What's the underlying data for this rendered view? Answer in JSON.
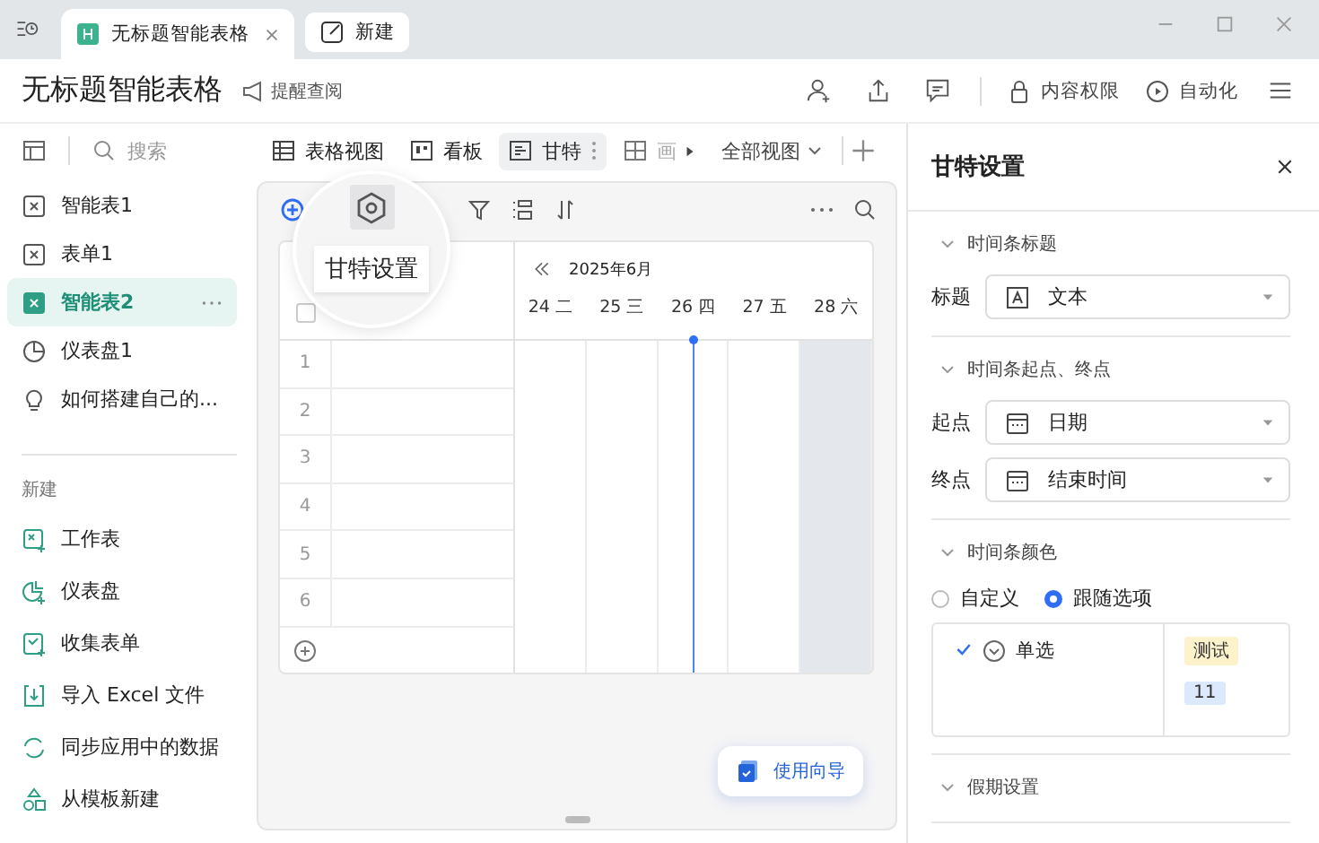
{
  "window": {
    "tabs": [
      {
        "title": "无标题智能表格",
        "selected": true,
        "kind": "doc"
      },
      {
        "title": "新建",
        "selected": false,
        "kind": "new"
      }
    ]
  },
  "header": {
    "title": "无标题智能表格",
    "remind": "提醒查阅",
    "actions": [
      {
        "label": "内容权限",
        "kind": "lock"
      },
      {
        "label": "自动化",
        "kind": "auto"
      }
    ]
  },
  "sidebar": {
    "search_placeholder": "搜索",
    "items": [
      {
        "label": "智能表1",
        "kind": "sheet",
        "selected": false
      },
      {
        "label": "表单1",
        "kind": "sheet",
        "selected": false
      },
      {
        "label": "智能表2",
        "kind": "sheet",
        "selected": true
      },
      {
        "label": "仪表盘1",
        "kind": "dashboard",
        "selected": false
      },
      {
        "label": "如何搭建自己的...",
        "kind": "bulb",
        "selected": false
      }
    ],
    "new_heading": "新建",
    "new_items": [
      {
        "label": "工作表",
        "kind": "sheet"
      },
      {
        "label": "仪表盘",
        "kind": "dashboard"
      },
      {
        "label": "收集表单",
        "kind": "form"
      },
      {
        "label": "导入 Excel 文件",
        "kind": "import"
      },
      {
        "label": "同步应用中的数据",
        "kind": "sync"
      },
      {
        "label": "从模板新建",
        "kind": "template"
      }
    ]
  },
  "views": [
    {
      "label": "表格视图",
      "kind": "grid",
      "selected": false
    },
    {
      "label": "看板",
      "kind": "board",
      "selected": false
    },
    {
      "label": "甘特",
      "kind": "gantt",
      "selected": true
    },
    {
      "label": "画",
      "kind": "gallery",
      "selected": false
    }
  ],
  "all_views": "全部视图",
  "tooltip": "甘特设置",
  "grid": {
    "select_all_checked": false,
    "rows": [
      "1",
      "2",
      "3",
      "4",
      "5",
      "6"
    ]
  },
  "gantt": {
    "month": "2025年6月",
    "days": [
      {
        "label": "24 二",
        "weekend": false,
        "today": false
      },
      {
        "label": "25 三",
        "weekend": false,
        "today": false
      },
      {
        "label": "26 四",
        "weekend": false,
        "today": true
      },
      {
        "label": "27 五",
        "weekend": false,
        "today": false
      },
      {
        "label": "28 六",
        "weekend": true,
        "today": false
      }
    ]
  },
  "guide_button": "使用向导",
  "panel": {
    "title": "甘特设置",
    "sections": [
      {
        "heading": "时间条标题",
        "fields": [
          {
            "label": "标题",
            "value": "文本",
            "kind": "text"
          }
        ]
      },
      {
        "heading": "时间条起点、终点",
        "fields": [
          {
            "label": "起点",
            "value": "日期",
            "kind": "date"
          },
          {
            "label": "终点",
            "value": "结束时间",
            "kind": "date"
          }
        ]
      },
      {
        "heading": "时间条颜色",
        "radios": [
          {
            "label": "自定义",
            "selected": false
          },
          {
            "label": "跟随选项",
            "selected": true
          }
        ],
        "mapping": {
          "field": "单选",
          "checked": true,
          "options": [
            {
              "label": "测试",
              "color": "#fcf2cc"
            },
            {
              "label": "11",
              "color": "#dce8fc"
            }
          ]
        }
      },
      {
        "heading": "假期设置"
      }
    ]
  }
}
